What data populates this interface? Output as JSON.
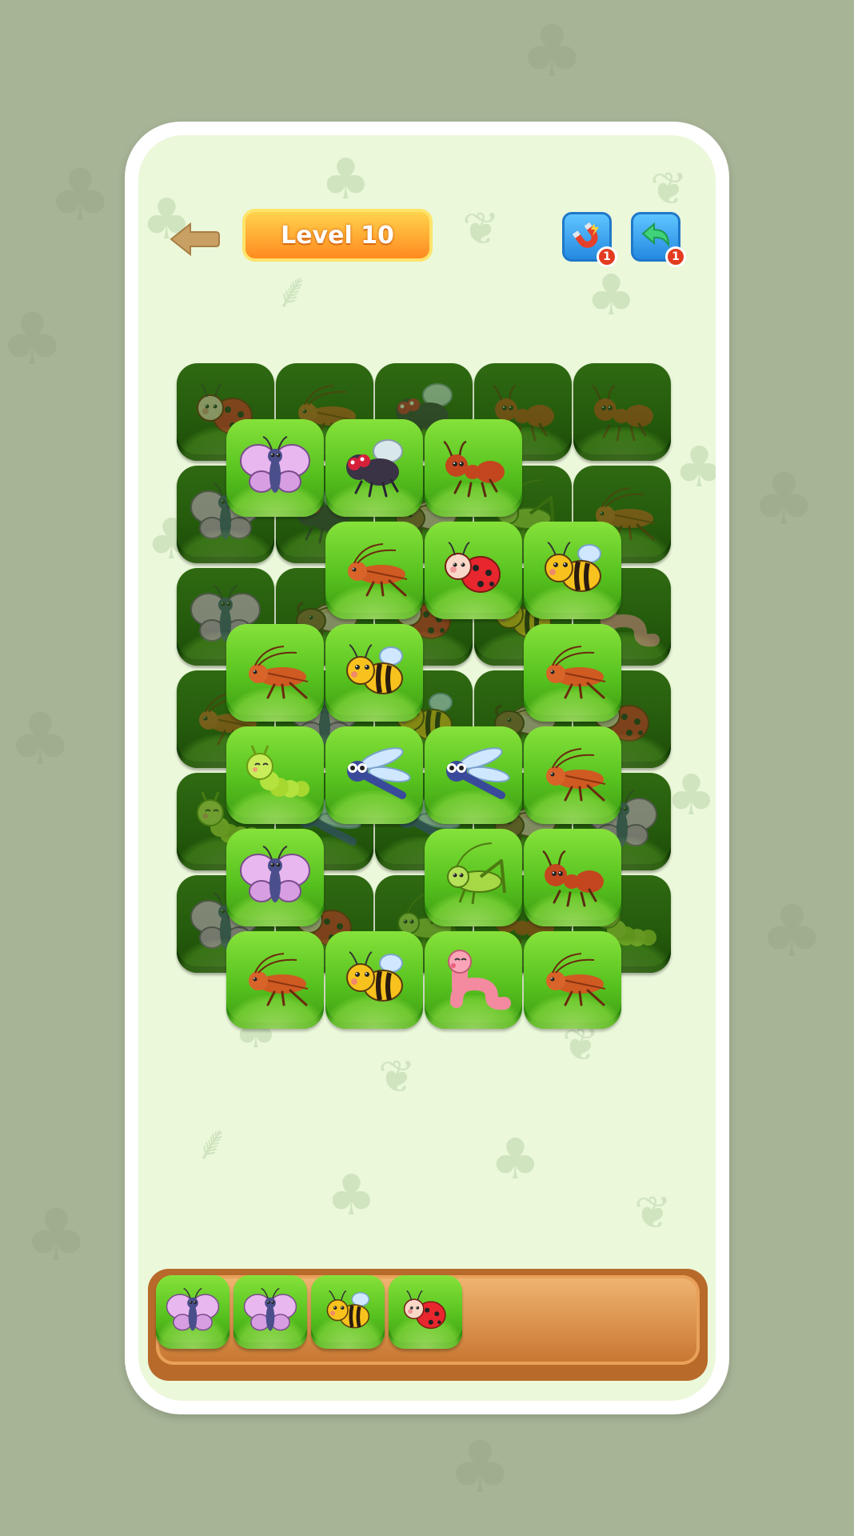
{
  "header": {
    "level_label": "Level 10",
    "magnet_count": "1",
    "undo_count": "1"
  },
  "colors": {
    "background": "#a7b496",
    "screen": "#ebf8da",
    "tile_green": "#57c21f",
    "tile_dark": "#245a0c",
    "level_pill": "#ff9a2a",
    "tool_button": "#2f92e6",
    "badge": "#e33b1f",
    "tray_wood": "#c7752f"
  },
  "board": {
    "bottom_layer": [
      [
        "ladybug",
        "cricket",
        "fly",
        "ant",
        "ant"
      ],
      [
        "butterfly",
        "fly",
        "beetle",
        "grasshopper",
        "cricket"
      ],
      [
        "butterfly",
        "beetle",
        "ladybug",
        "bee",
        "worm"
      ],
      [
        "cricket",
        "butterfly",
        "bee",
        "beetle",
        "ladybug"
      ],
      [
        "caterpillar",
        "dragonfly",
        "dragonfly",
        "beetle",
        "butterfly"
      ],
      [
        "butterfly",
        "ladybug",
        "grasshopper",
        "ant",
        "caterpillar"
      ]
    ],
    "top_layer": [
      [
        "butterfly",
        "fly",
        "ant"
      ],
      [
        "cricket",
        "ladybug",
        "bee"
      ],
      [
        "cricket",
        "bee",
        "cricket"
      ],
      [
        "caterpillar",
        "dragonfly",
        "dragonfly",
        "cricket"
      ],
      [
        "butterfly",
        "grasshopper",
        "ant"
      ],
      [
        "cricket",
        "bee",
        "worm",
        "cricket"
      ]
    ]
  },
  "tray": {
    "slots": [
      "butterfly",
      "butterfly",
      "bee",
      "ladybug"
    ],
    "capacity": 7
  }
}
